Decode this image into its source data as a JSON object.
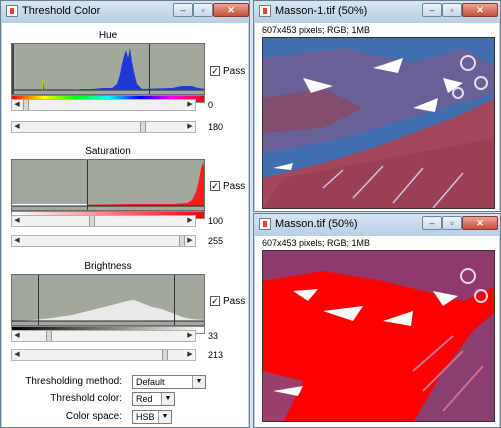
{
  "threshold_window": {
    "title": "Threshold Color",
    "hue": {
      "label": "Hue",
      "min_value": "0",
      "max_value": "180",
      "pass_checked": true,
      "pass_label": "Pass"
    },
    "saturation": {
      "label": "Saturation",
      "min_value": "100",
      "max_value": "255",
      "pass_checked": true,
      "pass_label": "Pass"
    },
    "brightness": {
      "label": "Brightness",
      "min_value": "33",
      "max_value": "213",
      "pass_checked": true,
      "pass_label": "Pass"
    },
    "thresholding_method": {
      "label": "Thresholding method:",
      "value": "Default"
    },
    "threshold_color": {
      "label": "Threshold color:",
      "value": "Red"
    },
    "color_space": {
      "label": "Color space:",
      "value": "HSB"
    }
  },
  "image_window_1": {
    "title": "Masson-1.tif (50%)",
    "info": "607x453 pixels; RGB; 1MB"
  },
  "image_window_2": {
    "title": "Masson.tif (50%)",
    "info": "607x453 pixels; RGB; 1MB"
  },
  "colors": {
    "histogram_bg": "#a2a89c",
    "threshold_red": "#ff0000",
    "tissue_blue": "#3f6fae",
    "tissue_red": "#a2475c"
  }
}
